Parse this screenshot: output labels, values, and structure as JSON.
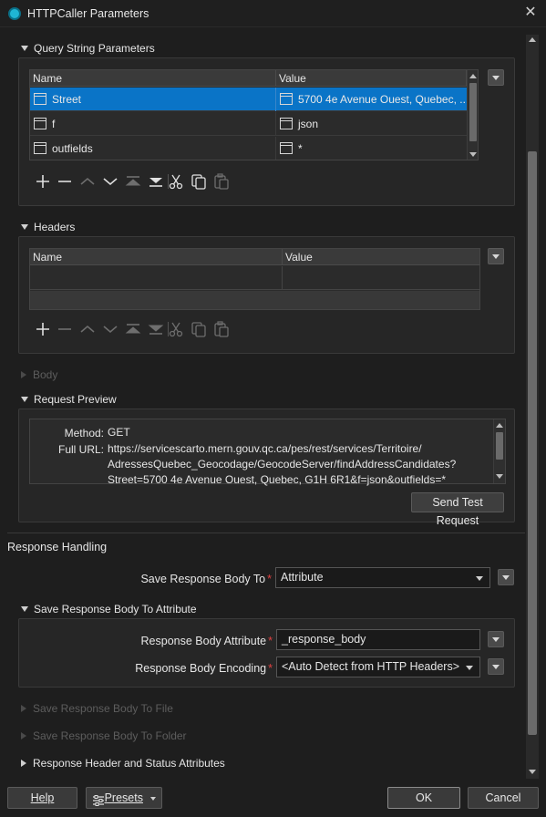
{
  "window": {
    "title": "HTTPCaller Parameters"
  },
  "query": {
    "section_title": "Query String Parameters",
    "col_name": "Name",
    "col_value": "Value",
    "rows": [
      {
        "name": "Street",
        "value": "5700 4e Avenue Ouest, Quebec, ..."
      },
      {
        "name": "f",
        "value": "json"
      },
      {
        "name": "outfields",
        "value": "*"
      }
    ]
  },
  "headers": {
    "section_title": "Headers",
    "col_name": "Name",
    "col_value": "Value"
  },
  "body": {
    "section_title": "Body"
  },
  "preview": {
    "section_title": "Request Preview",
    "method_label": "Method:",
    "method_value": "GET",
    "url_label": "Full URL:",
    "url_line1": "https://servicescarto.mern.gouv.qc.ca/pes/rest/services/Territoire/",
    "url_line2": "AdressesQuebec_Geocodage/GeocodeServer/findAddressCandidates?",
    "url_line3": "Street=5700 4e Avenue Ouest, Quebec, G1H 6R1&f=json&outfields=*",
    "send_button": "Send Test Request"
  },
  "response": {
    "section_title": "Response Handling",
    "save_to_label": "Save Response Body To",
    "save_to_value": "Attribute",
    "attr_section_title": "Save Response Body To Attribute",
    "body_attr_label": "Response Body Attribute",
    "body_attr_value": "_response_body",
    "encoding_label": "Response Body Encoding",
    "encoding_value": "<Auto Detect from HTTP Headers>",
    "to_file": "Save Response Body To File",
    "to_folder": "Save Response Body To Folder",
    "header_status": "Response Header and Status Attributes"
  },
  "footer": {
    "help": "Help",
    "presets": "Presets",
    "ok": "OK",
    "cancel": "Cancel"
  },
  "colors": {
    "selection": "#0a74c7",
    "required": "#e04040",
    "app_icon": "#1fb5d4"
  }
}
